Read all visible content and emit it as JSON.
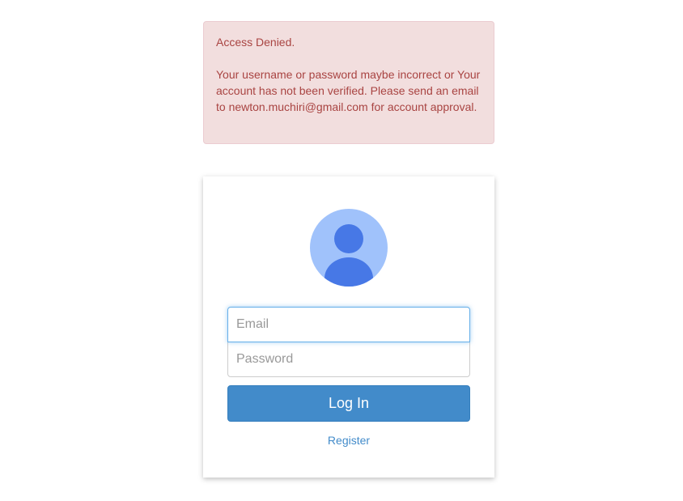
{
  "alert": {
    "title": "Access Denied.",
    "message": "Your username or password maybe incorrect or Your account has not been verified. Please send an email to newton.muchiri@gmail.com for account approval."
  },
  "login": {
    "avatar_icon": "user-avatar-icon",
    "email_placeholder": "Email",
    "password_placeholder": "Password",
    "submit_label": "Log In",
    "register_link": "Register"
  },
  "colors": {
    "alert_bg": "#f2dede",
    "alert_text": "#a94442",
    "primary": "#428bca",
    "avatar_bg": "#a0c2fb",
    "avatar_fg": "#4778e6"
  }
}
